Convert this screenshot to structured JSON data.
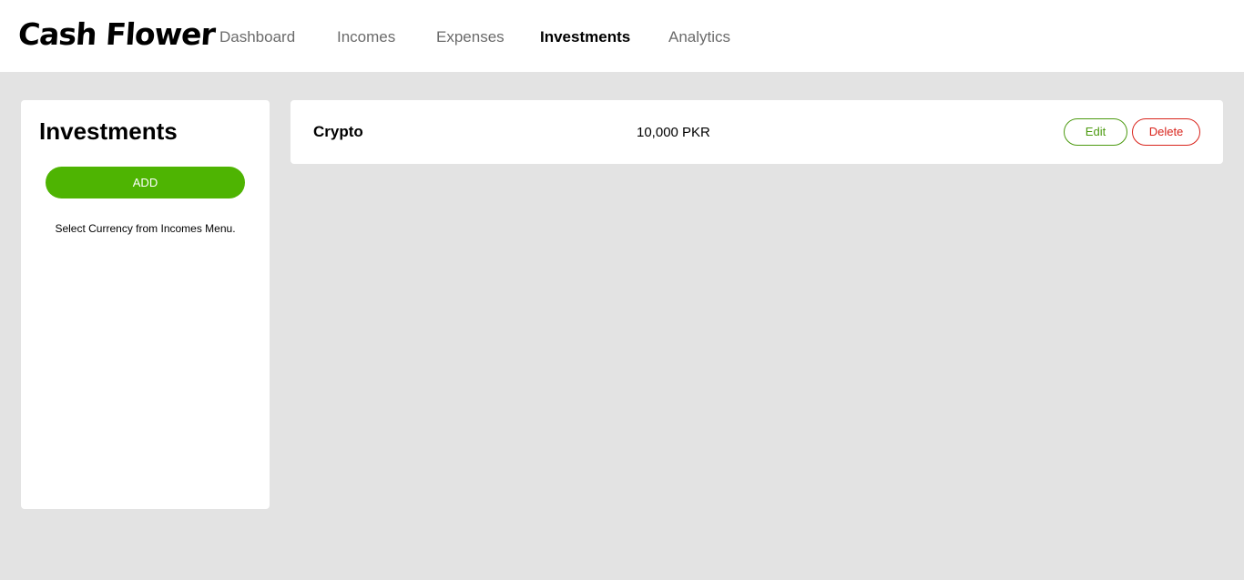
{
  "brand": "Cash Flower",
  "nav": {
    "items": [
      {
        "label": "Dashboard",
        "active": false
      },
      {
        "label": "Incomes",
        "active": false
      },
      {
        "label": "Expenses",
        "active": false
      },
      {
        "label": "Investments",
        "active": true
      },
      {
        "label": "Analytics",
        "active": false
      }
    ]
  },
  "sidebar": {
    "title": "Investments",
    "add_label": "ADD",
    "hint": "Select Currency from Incomes Menu."
  },
  "investments": [
    {
      "name": "Crypto",
      "amount": "10,000 PKR",
      "edit_label": "Edit",
      "delete_label": "Delete"
    }
  ],
  "colors": {
    "background": "#e3e3e3",
    "accent_green": "#4eb402",
    "edit_green": "#4c9a10",
    "delete_red": "#d9241c"
  }
}
